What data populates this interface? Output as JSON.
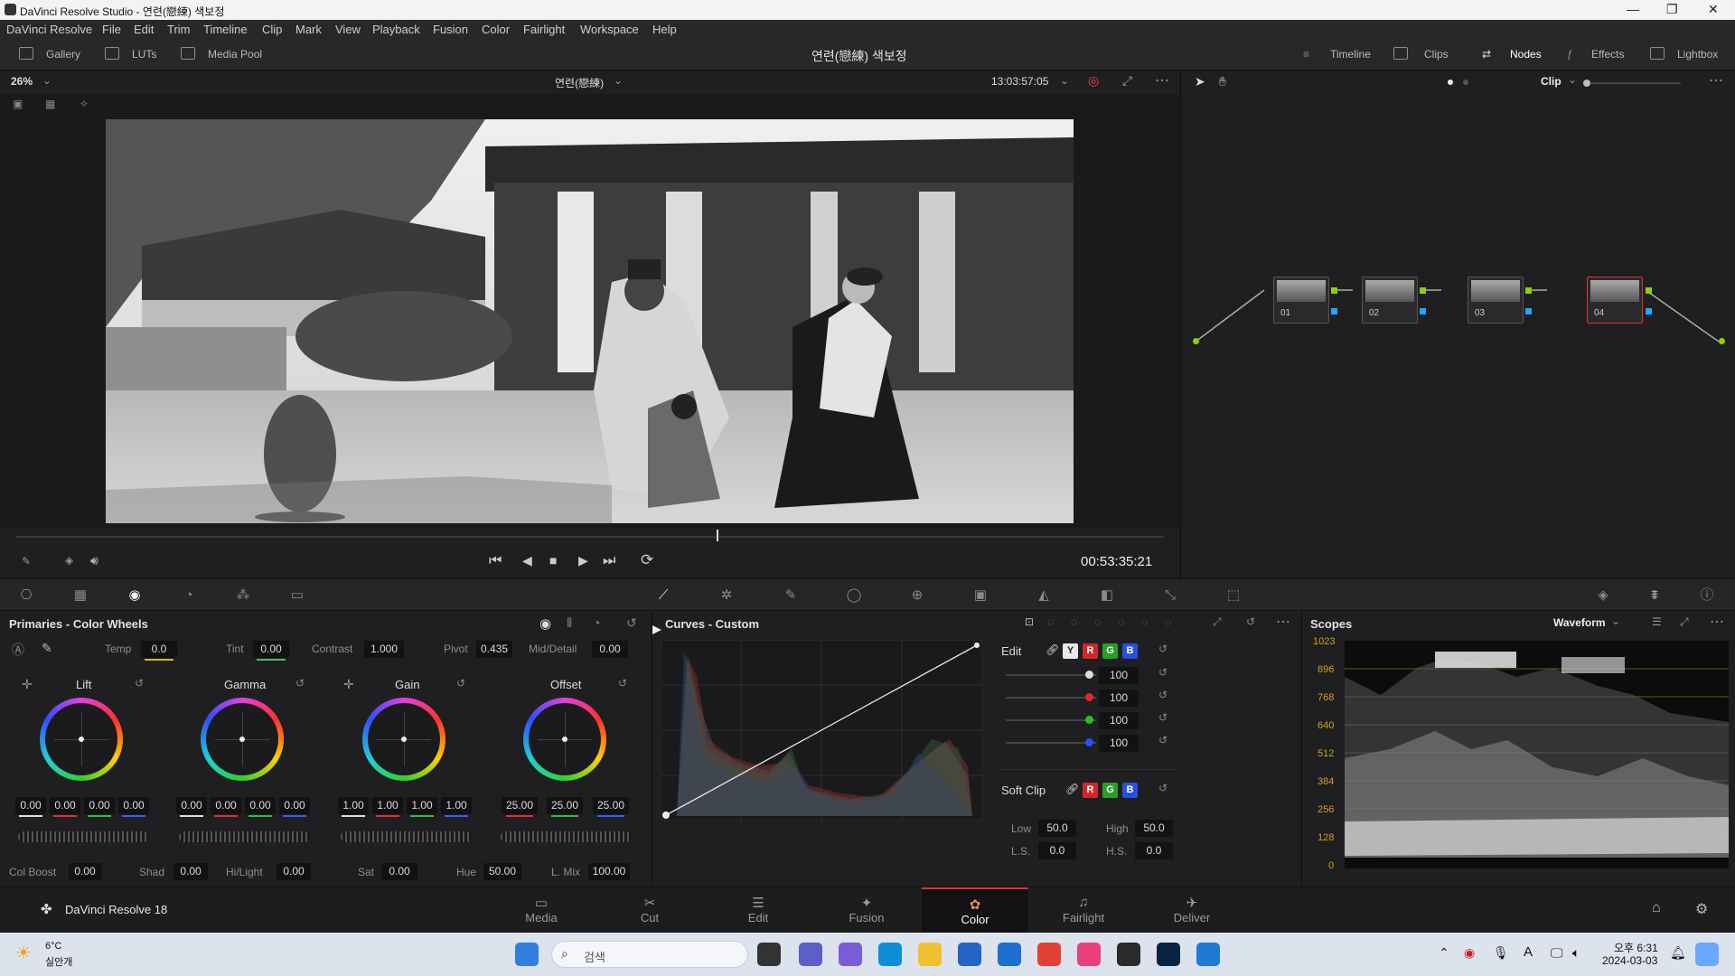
{
  "window": {
    "title": "DaVinci Resolve Studio - 연련(戀練) 색보정"
  },
  "menu": [
    "DaVinci Resolve",
    "File",
    "Edit",
    "Trim",
    "Timeline",
    "Clip",
    "Mark",
    "View",
    "Playback",
    "Fusion",
    "Color",
    "Fairlight",
    "Workspace",
    "Help"
  ],
  "toolbar": {
    "left": [
      "Gallery",
      "LUTs",
      "Media Pool"
    ],
    "project_title": "연련(戀練) 색보정",
    "right": [
      "Timeline",
      "Clips",
      "Nodes",
      "Effects",
      "Lightbox"
    ]
  },
  "viewer": {
    "zoom": "26%",
    "timeline_name": "연련(戀練)",
    "timecode": "13:03:57:05",
    "playhead_timecode": "00:53:35:21",
    "scrub_position": 0.61
  },
  "nodes_panel": {
    "mode": "Clip",
    "nodes": [
      {
        "label": "01",
        "selected": false
      },
      {
        "label": "02",
        "selected": false
      },
      {
        "label": "03",
        "selected": false
      },
      {
        "label": "04",
        "selected": true
      }
    ]
  },
  "primaries": {
    "title": "Primaries - Color Wheels",
    "params": {
      "temp_label": "Temp",
      "temp": "0.0",
      "tint_label": "Tint",
      "tint": "0.00",
      "contrast_label": "Contrast",
      "contrast": "1.000",
      "pivot_label": "Pivot",
      "pivot": "0.435",
      "middetail_label": "Mid/Detail",
      "middetail": "0.00"
    },
    "wheels": [
      {
        "name": "Lift",
        "values": [
          "0.00",
          "0.00",
          "0.00",
          "0.00"
        ]
      },
      {
        "name": "Gamma",
        "values": [
          "0.00",
          "0.00",
          "0.00",
          "0.00"
        ]
      },
      {
        "name": "Gain",
        "values": [
          "1.00",
          "1.00",
          "1.00",
          "1.00"
        ]
      },
      {
        "name": "Offset",
        "values": [
          "25.00",
          "25.00",
          "25.00"
        ]
      }
    ],
    "bottom": {
      "colboost_label": "Col Boost",
      "colboost": "0.00",
      "shad_label": "Shad",
      "shad": "0.00",
      "hilight_label": "Hi/Light",
      "hilight": "0.00",
      "sat_label": "Sat",
      "sat": "0.00",
      "hue_label": "Hue",
      "hue": "50.00",
      "lmix_label": "L. Mix",
      "lmix": "100.00"
    }
  },
  "curves": {
    "title": "Curves - Custom",
    "edit_label": "Edit",
    "channel_buttons": [
      "Y",
      "R",
      "G",
      "B"
    ],
    "intensity": [
      "100",
      "100",
      "100",
      "100"
    ],
    "softclip_label": "Soft Clip",
    "softclip_buttons": [
      "R",
      "G",
      "B"
    ],
    "low_label": "Low",
    "low": "50.0",
    "high_label": "High",
    "high": "50.0",
    "ls_label": "L.S.",
    "ls": "0.0",
    "hs_label": "H.S.",
    "hs": "0.0"
  },
  "scopes": {
    "title": "Scopes",
    "mode": "Waveform",
    "scale": [
      "1023",
      "896",
      "768",
      "640",
      "512",
      "384",
      "256",
      "128",
      "0"
    ]
  },
  "pages": {
    "app_name": "DaVinci Resolve 18",
    "items": [
      "Media",
      "Cut",
      "Edit",
      "Fusion",
      "Color",
      "Fairlight",
      "Deliver"
    ],
    "active": "Color"
  },
  "taskbar": {
    "weather_temp": "6°C",
    "weather_desc": "실안개",
    "search_placeholder": "검색",
    "time": "오후 6:31",
    "date": "2024-03-03"
  },
  "colors": {
    "accent_red": "#e03030",
    "node_out_green": "#8fd000",
    "node_in_blue": "#20a8ff"
  }
}
